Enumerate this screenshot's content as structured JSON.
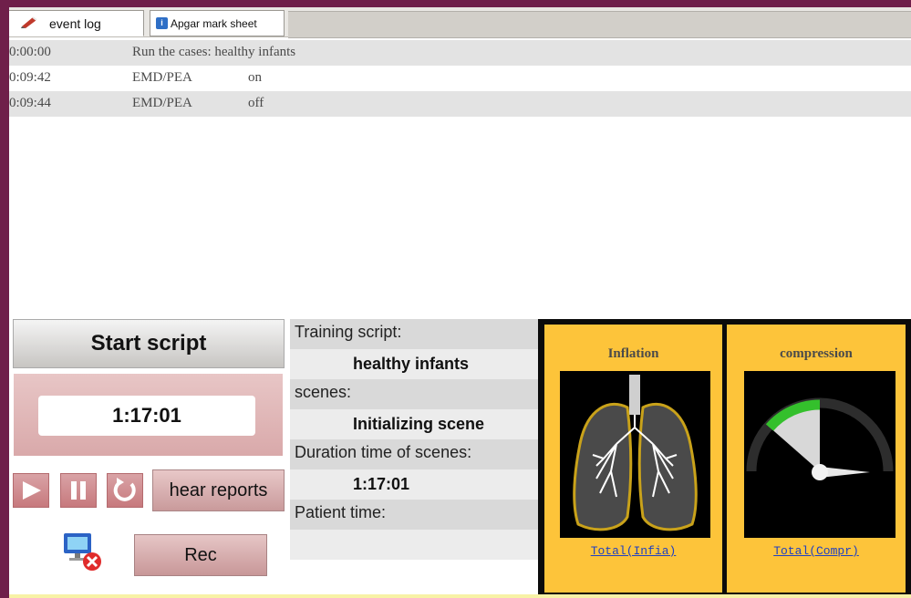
{
  "tabs": [
    {
      "label": "event log",
      "icon": "pencil-icon",
      "active": true
    },
    {
      "label": "Apgar mark sheet",
      "icon": "sheet-icon",
      "active": false
    }
  ],
  "log": [
    {
      "time": "0:00:00",
      "text": "Run the cases:  healthy infants"
    },
    {
      "time": "0:09:42",
      "event": "EMD/PEA",
      "value": "on"
    },
    {
      "time": "0:09:44",
      "event": "EMD/PEA",
      "value": "off"
    }
  ],
  "controls": {
    "start_label": "Start script",
    "timer": "1:17:01",
    "hear_reports_label": "hear reports",
    "rec_label": "Rec",
    "icons": [
      "play-icon",
      "pause-icon",
      "reset-icon",
      "network-disconnected-icon"
    ]
  },
  "info": {
    "training_script_label": "Training script:",
    "training_script_value": "healthy infants",
    "scenes_label": "scenes:",
    "scenes_value": "Initializing scene",
    "duration_label": "Duration time of scenes:",
    "duration_value": "1:17:01",
    "patient_time_label": "Patient time:",
    "patient_time_value": ""
  },
  "monitor": {
    "inflation_title": "Inflation",
    "inflation_link": "Total(Infia)",
    "compression_title": "compression",
    "compression_link": "Total(Compr)"
  },
  "colors": {
    "frame": "#6f1f4a",
    "card": "#fdc43a",
    "button": "#c7797d",
    "gauge_green": "#34c02c",
    "lung_outline": "#c9a21a"
  }
}
